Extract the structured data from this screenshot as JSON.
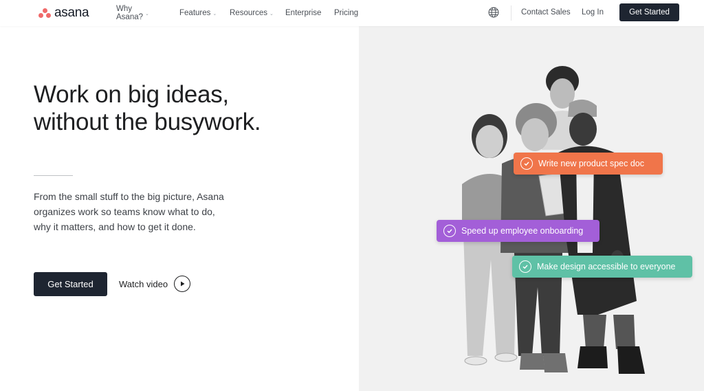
{
  "brand": {
    "name": "asana",
    "logo_color": "#f06a6a"
  },
  "nav": {
    "links": [
      {
        "label": "Why Asana?",
        "dropdown": true
      },
      {
        "label": "Features",
        "dropdown": true
      },
      {
        "label": "Resources",
        "dropdown": true
      },
      {
        "label": "Enterprise",
        "dropdown": false
      },
      {
        "label": "Pricing",
        "dropdown": false
      }
    ],
    "globe_icon": "globe-icon",
    "contact_sales": "Contact Sales",
    "login": "Log In",
    "cta": "Get Started"
  },
  "hero": {
    "title_line1": "Work on big ideas,",
    "title_line2": "without the busywork.",
    "sub_line1": "From the small stuff to the big picture, Asana",
    "sub_line2": "organizes work so teams know what to do,",
    "sub_line3": "why it matters, and how to get it done.",
    "cta": "Get Started",
    "watch_video": "Watch video"
  },
  "tasks": [
    {
      "label": "Write new product spec doc",
      "color": "#f0754a"
    },
    {
      "label": "Speed up employee onboarding",
      "color": "#a35fd8"
    },
    {
      "label": "Make design accessible to everyone",
      "color": "#5fc1a6"
    }
  ],
  "colors": {
    "dark": "#1e2531",
    "panel": "#f1f1f1"
  }
}
